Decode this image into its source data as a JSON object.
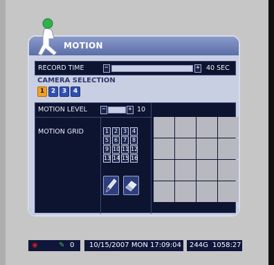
{
  "dialog": {
    "title": "MOTION",
    "record_time": {
      "label": "RECORD TIME",
      "value": "40 SEC"
    },
    "camera_selection": {
      "label": "CAMERA SELECTION",
      "cameras": [
        "1",
        "2",
        "3",
        "4"
      ],
      "selected": "1"
    },
    "motion_level": {
      "label": "MOTION LEVEL",
      "value": "10"
    },
    "motion_grid": {
      "label": "MOTION GRID",
      "numbers": [
        "1",
        "2",
        "3",
        "4",
        "5",
        "6",
        "7",
        "8",
        "9",
        "10",
        "11",
        "12",
        "13",
        "14",
        "15",
        "16"
      ]
    }
  },
  "status_bar": {
    "channel": "0",
    "datetime": "10/15/2007 MON 17:09:04",
    "storage": "244G",
    "time_remaining": "1058:27"
  },
  "colors": {
    "dialog_header": "#5c6ea8",
    "dialog_body": "#c9cfe2",
    "panel_bg": "#0d1430",
    "selected_camera": "#f0a020",
    "unselected_camera": "#2f4fb2"
  }
}
